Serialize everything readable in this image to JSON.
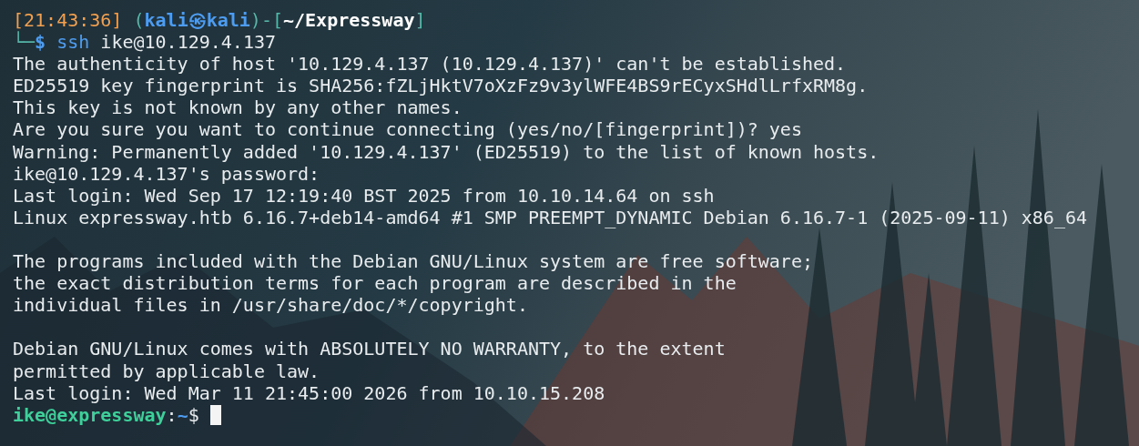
{
  "prompt": {
    "header": [
      {
        "kind": "time",
        "text": "[21:43:36]"
      },
      {
        "kind": "frame",
        "text": " ("
      },
      {
        "kind": "user",
        "text": "kali"
      },
      {
        "kind": "user",
        "text": "㉿"
      },
      {
        "kind": "user",
        "text": "kali"
      },
      {
        "kind": "frame",
        "text": ")-["
      },
      {
        "kind": "path",
        "text": "~/Expressway"
      },
      {
        "kind": "frame",
        "text": "]"
      }
    ],
    "command": [
      {
        "kind": "frame",
        "text": "└─"
      },
      {
        "kind": "user",
        "text": "$"
      },
      {
        "kind": "cmd",
        "text": " ssh"
      },
      {
        "kind": "plain",
        "text": " ike@10.129.4.137"
      }
    ]
  },
  "output": [
    [
      "The authenticity of host '10.129.4.137 (10.129.4.137)' can't be established.",
      "ED25519 key fingerprint is SHA256:fZLjHktV7oXzFz9v3ylWFE4BS9rECyxSHdlLrfxRM8g.",
      "This key is not known by any other names.",
      "Are you sure you want to continue connecting (yes/no/[fingerprint])? yes",
      "Warning: Permanently added '10.129.4.137' (ED25519) to the list of known hosts.",
      "ike@10.129.4.137's password:",
      "Last login: Wed Sep 17 12:19:40 BST 2025 from 10.10.14.64 on ssh",
      "Linux expressway.htb 6.16.7+deb14-amd64 #1 SMP PREEMPT_DYNAMIC Debian 6.16.7-1 (2025-09-11) x86_64"
    ],
    [
      "The programs included with the Debian GNU/Linux system are free software;",
      "the exact distribution terms for each program are described in the",
      "individual files in /usr/share/doc/*/copyright."
    ],
    [
      "Debian GNU/Linux comes with ABSOLUTELY NO WARRANTY, to the extent",
      "permitted by applicable law.",
      "Last login: Wed Mar 11 21:45:00 2026 from 10.10.15.208"
    ]
  ],
  "remote_prompt": [
    {
      "kind": "ruser",
      "text": "ike@expressway"
    },
    {
      "kind": "plain",
      "text": ":"
    },
    {
      "kind": "rpath",
      "text": "~"
    },
    {
      "kind": "plain",
      "text": "$ "
    }
  ]
}
